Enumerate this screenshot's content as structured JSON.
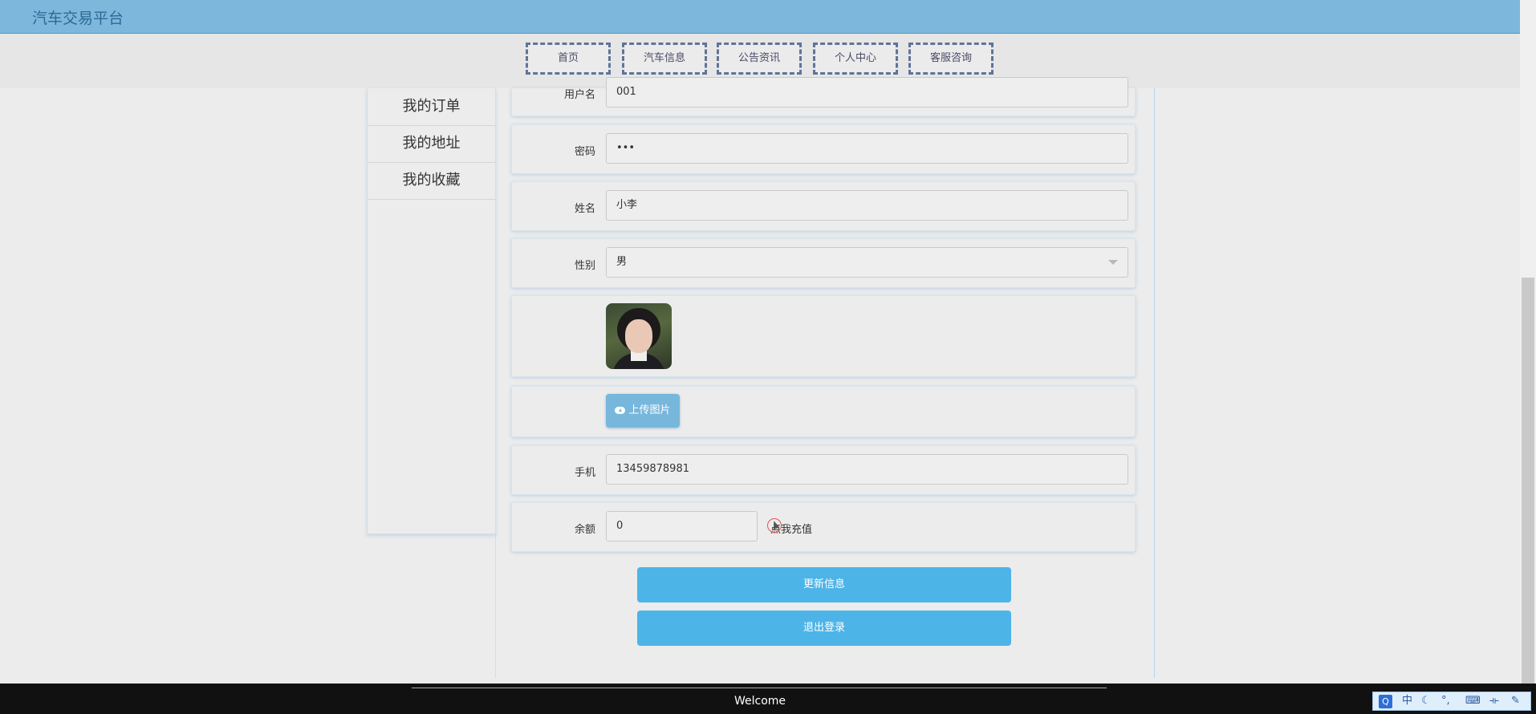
{
  "app": {
    "title": "汽车交易平台"
  },
  "nav": [
    {
      "label": "首页"
    },
    {
      "label": "汽车信息"
    },
    {
      "label": "公告资讯"
    },
    {
      "label": "个人中心"
    },
    {
      "label": "客服咨询"
    }
  ],
  "sidebar": {
    "items": [
      {
        "label": "我的订单"
      },
      {
        "label": "我的地址"
      },
      {
        "label": "我的收藏"
      }
    ]
  },
  "form": {
    "username": {
      "label": "用户名",
      "value": "001"
    },
    "password": {
      "label": "密码",
      "value": "•••"
    },
    "name": {
      "label": "姓名",
      "value": "小李"
    },
    "gender": {
      "label": "性别",
      "value": "男"
    },
    "upload_label": "上传图片",
    "phone": {
      "label": "手机",
      "value": "13459878981"
    },
    "balance": {
      "label": "余额",
      "value": "0",
      "recharge_label": "点我充值"
    }
  },
  "actions": {
    "update_label": "更新信息",
    "logout_label": "退出登录"
  },
  "footer": {
    "text": "Welcome"
  },
  "tray": {
    "items": [
      "Q",
      "中"
    ]
  },
  "colors": {
    "header": "#7db8dc",
    "primary_button": "#4db4e8",
    "nav_border": "#5f7497"
  }
}
